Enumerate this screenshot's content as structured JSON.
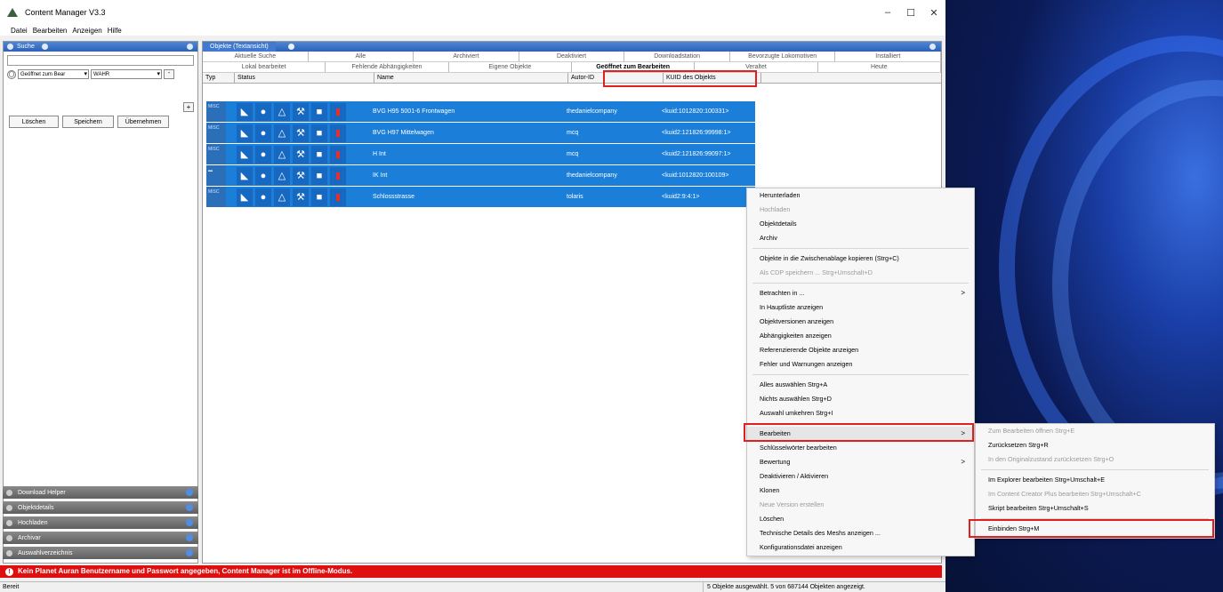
{
  "window": {
    "title": "Content Manager V3.3",
    "controls": [
      "–",
      "☐",
      "✕"
    ]
  },
  "menubar": [
    "Datei",
    "Bearbeiten",
    "Anzeigen",
    "Hilfe"
  ],
  "search_panel": {
    "title": "Suche",
    "search_value": "",
    "filter_field": "Geöffnet zum Bear",
    "filter_value": "WAHR",
    "plus_label": "+",
    "minus_label": "-",
    "buttons": [
      "Löschen",
      "Speichern",
      "Übernehmen"
    ]
  },
  "dock_panels": [
    "Download Helper",
    "Objektdetails",
    "Hochladen",
    "Archivar",
    "Auswahlverzeichnis"
  ],
  "list_panel": {
    "title": "Objekte (Textansicht)",
    "tabs_row1": [
      "Aktuelle Suche",
      "Alle",
      "Archiviert",
      "Deaktiviert",
      "Downloadstation",
      "Bevorzugte Lokomotiven",
      "Installiert"
    ],
    "tabs_row2": [
      "Lokal bearbeitet",
      "Fehlende Abhängigkeiten",
      "Eigene Objekte",
      "Geöffnet zum Bearbeiten",
      "Veraltet",
      "Heute"
    ],
    "columns": [
      "Typ",
      "Status",
      "Name",
      "Autor-ID",
      "KUID des Objekts"
    ],
    "rows": [
      {
        "type": "MISC",
        "name": "BVG H95 5001-6 Frontwagen",
        "author": "thedanielcompany",
        "kuid": "<kuid:1012820:100331>"
      },
      {
        "type": "MISC",
        "name": "BVG H97 Mittelwagen",
        "author": "mcq",
        "kuid": "<kuid2:121826:99998:1>"
      },
      {
        "type": "MISC",
        "name": "H Int",
        "author": "mcq",
        "kuid": "<kuid2:121826:99097:1>"
      },
      {
        "type": "",
        "name": "IK Int",
        "author": "thedanielcompany",
        "kuid": "<kuid:1012820:100109>"
      },
      {
        "type": "MISC",
        "name": "Schlossstrasse",
        "author": "tolaris",
        "kuid": "<kuid2:9:4:1>"
      }
    ]
  },
  "context_menu": {
    "items": [
      "Herunterladen",
      "Hochladen",
      "Objektdetails",
      "Archiv",
      "Objekte in die Zwischenablage kopieren (Strg+C)",
      "Als CDP speichern ... Strg+Umschalt+D",
      "Betrachten in ...",
      "In Hauptliste anzeigen",
      "Objektversionen anzeigen",
      "Abhängigkeiten anzeigen",
      "Referenzierende Objekte anzeigen",
      "Fehler und Warnungen anzeigen",
      "Alles auswählen Strg+A",
      "Nichts auswählen Strg+D",
      "Auswahl umkehren Strg+I",
      "Bearbeiten",
      "Schlüsselwörter bearbeiten",
      "Bewertung",
      "Deaktivieren / Aktivieren",
      "Klonen",
      "Neue Version erstellen",
      "Löschen",
      "Technische Details des Meshs anzeigen ...",
      "Konfigurationsdatei anzeigen"
    ],
    "arrow": ">"
  },
  "submenu": {
    "items": [
      "Zum Bearbeiten öffnen Strg+E",
      "Zurücksetzen Strg+R",
      "In den Originalzustand zurücksetzen Strg+O",
      "Im Explorer bearbeiten Strg+Umschalt+E",
      "Im Content Creator Plus bearbeiten Strg+Umschalt+C",
      "Skript bearbeiten Strg+Umschalt+S",
      "Einbinden Strg+M"
    ]
  },
  "warning": "Kein Planet Auran Benutzername und Passwort angegeben, Content Manager ist im Offline-Modus.",
  "statusbar": {
    "left": "Bereit",
    "right": "5 Objekte ausgewählt. 5 von 687144 Objekten angezeigt."
  },
  "colors": {
    "selection": "#1b7fd9",
    "header_blue": "#2d62b5",
    "warning": "#e00f0f",
    "highlight": "#e02020"
  }
}
